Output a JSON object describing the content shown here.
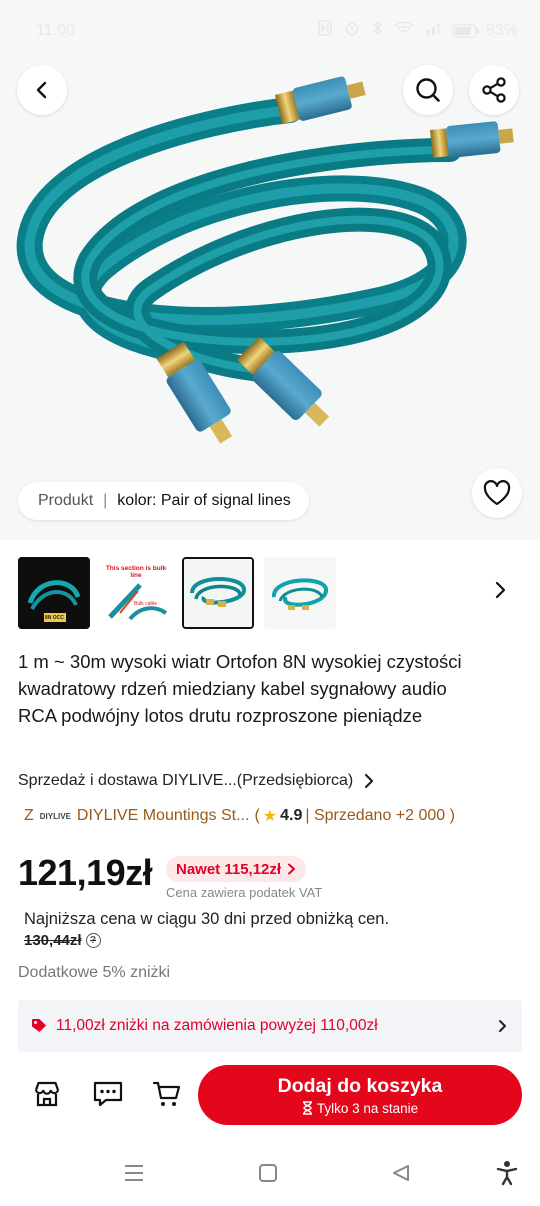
{
  "status_bar": {
    "time": "11:00",
    "battery": "83%"
  },
  "hero": {
    "variant_label": "Produkt",
    "variant_separator": "|",
    "variant_value": "kolor: Pair of signal lines"
  },
  "thumbnails": {
    "thumb1_badge": "8N OCC",
    "thumb2_line1": "This section is bulk line",
    "thumb2_line2": "Bulk cable"
  },
  "product": {
    "title": "1 m ~ 30m wysoki wiatr Ortofon 8N wysokiej czystości kwadratowy rdzeń miedziany kabel sygnałowy audio RCA podwójny lotos drutu rozproszone pieniądze",
    "seller": "Sprzedaż i dostawa DIYLIVE...(Przedsiębiorca)",
    "store_prefix": "Z",
    "store_logo": "DIYLIVE",
    "store_name": "DIYLIVE Mountings St...",
    "store_open": "(",
    "rating": "4.9",
    "sold": "| Sprzedano +2 000 )"
  },
  "pricing": {
    "price": "121,19zł",
    "promo": "Nawet 115,12zł",
    "vat_note": "Cena zawiera podatek VAT",
    "lowest_price_text": "Najniższa cena w ciągu 30 dni przed obniżką cen.",
    "old_price": "130,44zł",
    "extra_discount": "Dodatkowe 5% zniżki",
    "coupon": "11,00zł zniżki na zamówienia powyżej 110,00zł"
  },
  "actions": {
    "add_to_cart": "Dodaj do koszyka",
    "stock": "Tylko 3 na stanie"
  },
  "colors": {
    "accent": "#e4061b",
    "store_text": "#9a5a1c",
    "cable": "#0d8f9a"
  }
}
